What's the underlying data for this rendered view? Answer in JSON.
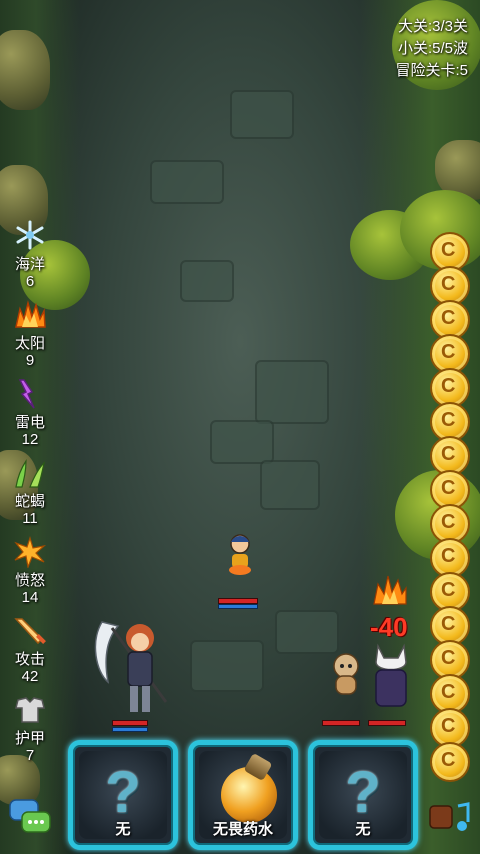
{
  "hud": {
    "big_stage": "大关:3/3关",
    "small_stage": "小关:5/5波",
    "adventure_level": "冒险关卡:5"
  },
  "elements": [
    {
      "icon": "snowflake-icon",
      "name": "海洋",
      "count": "6"
    },
    {
      "icon": "sun-icon",
      "name": "太阳",
      "count": "9"
    },
    {
      "icon": "thunder-icon",
      "name": "雷电",
      "count": "12"
    },
    {
      "icon": "scorpion-icon",
      "name": "蛇蝎",
      "count": "11"
    },
    {
      "icon": "fury-icon",
      "name": "愤怒",
      "count": "14"
    },
    {
      "icon": "sword-icon",
      "name": "攻击",
      "count": "42"
    },
    {
      "icon": "armor-icon",
      "name": "护甲",
      "count": "7"
    }
  ],
  "damage_text": "-40",
  "slots": [
    {
      "icon": "question-mark-icon",
      "label": "无"
    },
    {
      "icon": "potion-icon",
      "label": "无畏药水"
    },
    {
      "icon": "question-mark-icon",
      "label": "无"
    }
  ],
  "coin_column": {
    "count": 16,
    "symbol": "C"
  },
  "colors": {
    "slot_border": "#2cc3dc",
    "hp": "#d32525",
    "mp": "#2a7bd8",
    "damage": "#ff3b26"
  }
}
